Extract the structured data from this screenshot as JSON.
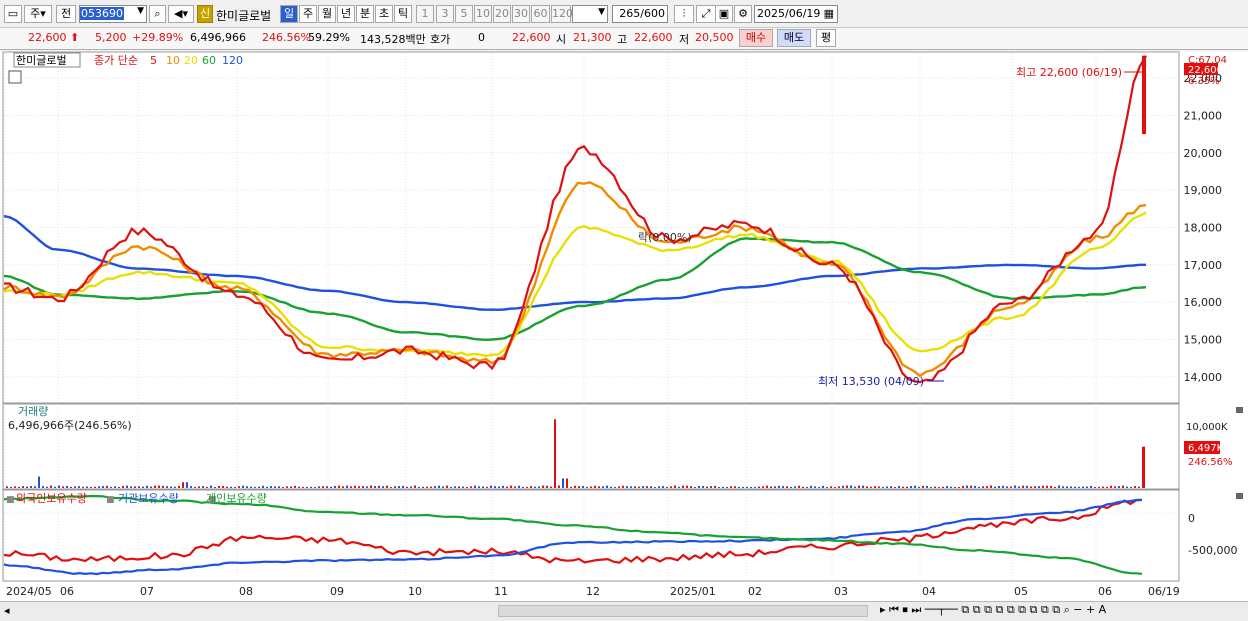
{
  "toolbar": {
    "market_btn": "주",
    "prev_btn": "전",
    "stock_code": "053690",
    "new_badge": "신",
    "stock_name": "한미글로벌",
    "periods": [
      "일",
      "주",
      "월",
      "년",
      "분",
      "초",
      "틱"
    ],
    "intervals": [
      "1",
      "3",
      "5",
      "10",
      "20",
      "30",
      "60",
      "120"
    ],
    "count_value": "265",
    "count_max": "/600",
    "date_value": "2025/06/19"
  },
  "quote": {
    "price": "22,600",
    "change": "5,200",
    "change_pct": "+29.89%",
    "volume": "6,496,966",
    "volume_ratio": "246.56%",
    "turnover": "59.29%",
    "amount": "143,528백만",
    "bid_label": "호가",
    "bid_value": "0",
    "price2": "22,600",
    "open_label": "시",
    "open": "21,300",
    "high_label": "고",
    "high": "22,600",
    "low_label": "저",
    "low": "20,500",
    "buy_btn": "매수",
    "sell_btn": "매도",
    "eval_btn": "평"
  },
  "price_panel": {
    "stock_label": "한미글로벌",
    "ma_title": "종가 단순",
    "ma_periods": [
      "5",
      "10",
      "20",
      "60",
      "120"
    ],
    "ma_colors": [
      "#e01010",
      "#f08c00",
      "#e8e000",
      "#18a030",
      "#2050e0"
    ],
    "yticks": [
      "22,000",
      "21,000",
      "20,000",
      "19,000",
      "18,000",
      "17,000",
      "16,000",
      "15,000",
      "14,000"
    ],
    "top_right_label": "C:67.04",
    "current_price_tag": "22,600",
    "current_pct_tag": "6.35%",
    "max_label": "최고 22,600 (06/19)",
    "min_label": "최저 13,530 (04/09)",
    "overlay_text": "락(0.00%)"
  },
  "volume_panel": {
    "title": "거래량",
    "value_label": "6,496,966주(246.56%)",
    "ytick": "10,000K",
    "current_tag": "6,497K",
    "current_pct": "246.56%"
  },
  "holder_panel": {
    "series_labels": [
      "외국인보유수량",
      "기관보유수량",
      "개인보유수량"
    ],
    "series_colors": [
      "#e01010",
      "#2050e0",
      "#18a030"
    ],
    "yticks": [
      "0",
      "-500,000"
    ]
  },
  "xaxis": {
    "labels": [
      "2024/05",
      "06",
      "07",
      "08",
      "09",
      "10",
      "11",
      "12",
      "2025/01",
      "02",
      "03",
      "04",
      "05",
      "06",
      "06/19"
    ]
  },
  "chart_data": {
    "type": "line",
    "title": "한미글로벌 (053690) 일봉",
    "ylim": [
      13300,
      22700
    ],
    "x": [
      "2024/05",
      "2024/06",
      "2024/07",
      "2024/08",
      "2024/09",
      "2024/10",
      "2024/11",
      "2024/12",
      "2025/01",
      "2025/02",
      "2025/03",
      "2025/04",
      "2025/05",
      "2025/06",
      "2025/06/19"
    ],
    "series": [
      {
        "name": "5",
        "values": [
          16400,
          16100,
          17900,
          16200,
          14400,
          14700,
          14300,
          20100,
          17700,
          18100,
          17000,
          13800,
          16000,
          17800,
          22600
        ]
      },
      {
        "name": "10",
        "values": [
          16400,
          16150,
          17500,
          16350,
          14600,
          14700,
          14400,
          19200,
          17600,
          18000,
          17000,
          14100,
          15900,
          17700,
          18600
        ]
      },
      {
        "name": "20",
        "values": [
          16300,
          16200,
          16800,
          16500,
          14800,
          14700,
          14600,
          18000,
          17400,
          17800,
          17100,
          14700,
          15600,
          17400,
          18400
        ]
      },
      {
        "name": "60",
        "values": [
          16700,
          16200,
          16100,
          16300,
          15700,
          15200,
          15000,
          15900,
          16600,
          17700,
          17600,
          16800,
          16100,
          16200,
          16400
        ]
      },
      {
        "name": "120",
        "values": [
          18300,
          17400,
          16900,
          16700,
          16300,
          16000,
          15800,
          16000,
          16100,
          16400,
          16700,
          16900,
          17000,
          16900,
          17000
        ]
      }
    ],
    "max_point": {
      "date": "06/19",
      "value": 22600
    },
    "min_point": {
      "date": "04/09",
      "value": 13530
    },
    "volume": {
      "last": 6496966,
      "spike_date": "2024/11 late",
      "spike_value": 10800000
    },
    "holdings": {
      "외국인보유수량": [
        -450000,
        -520000,
        -480000,
        -270000,
        -300000,
        -440000,
        -430000,
        -540000,
        -510000,
        -460000,
        -380000,
        -300000,
        -150000,
        -60000,
        150000
      ],
      "기관보유수량": [
        -580000,
        -680000,
        -630000,
        -550000,
        -530000,
        -520000,
        -480000,
        -330000,
        -320000,
        -310000,
        -290000,
        -210000,
        -60000,
        10000,
        150000
      ],
      "개인보유수량": [
        160000,
        190000,
        140000,
        100000,
        10000,
        -20000,
        -60000,
        -140000,
        -210000,
        -270000,
        -300000,
        -340000,
        -420000,
        -500000,
        -680000
      ]
    }
  }
}
